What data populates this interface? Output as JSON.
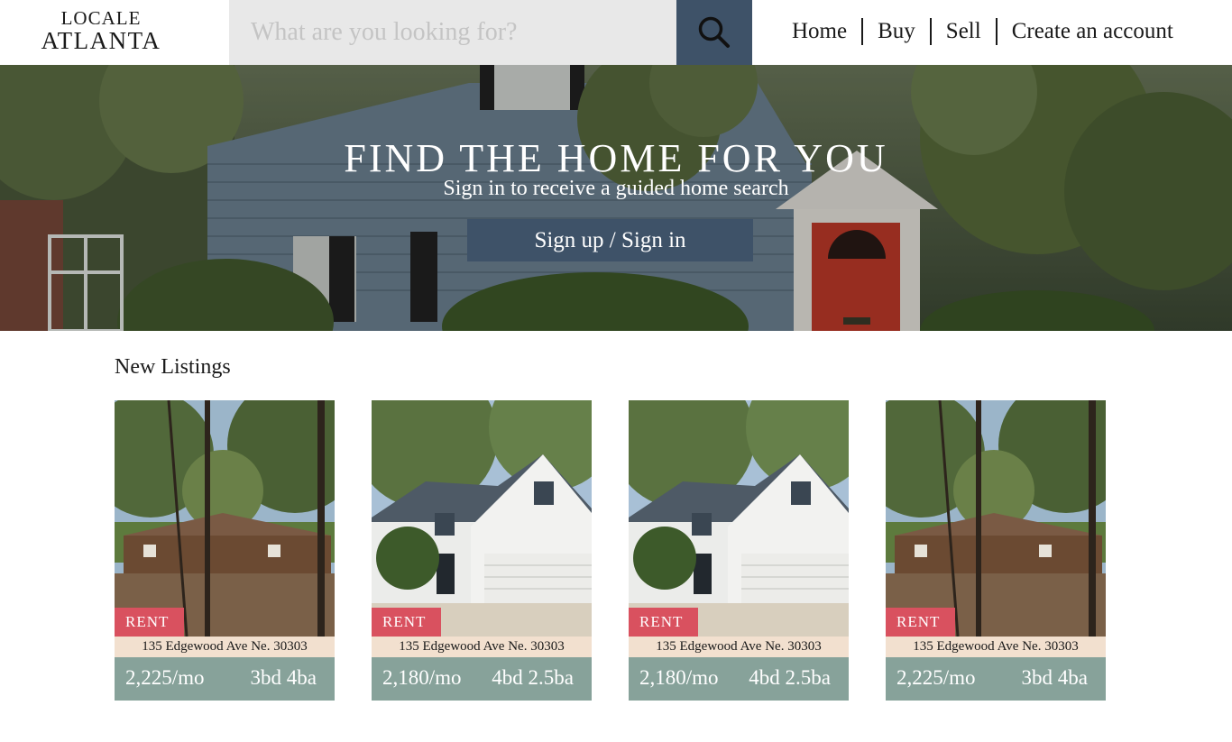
{
  "header": {
    "logo_line1": "LOCALE",
    "logo_line2": "ATLANTA",
    "search_placeholder": "What are you looking for?",
    "search_icon": "search-icon",
    "nav": [
      "Home",
      "Buy",
      "Sell",
      "Create an account"
    ]
  },
  "hero": {
    "title": "FIND THE HOME FOR YOU",
    "subtitle": "Sign in to receive a guided home search",
    "button": "Sign up / Sign in"
  },
  "listings": {
    "title": "New Listings",
    "items": [
      {
        "badge": "RENT",
        "address": "135 Edgewood Ave Ne. 30303",
        "price": "2,225/mo",
        "beds": "3bd 4ba"
      },
      {
        "badge": "RENT",
        "address": "135 Edgewood Ave Ne. 30303",
        "price": "2,180/mo",
        "beds": "4bd 2.5ba"
      },
      {
        "badge": "RENT",
        "address": "135 Edgewood Ave Ne. 30303",
        "price": "2,180/mo",
        "beds": "4bd 2.5ba"
      },
      {
        "badge": "RENT",
        "address": "135 Edgewood Ave Ne. 30303",
        "price": "2,225/mo",
        "beds": "3bd 4ba"
      }
    ]
  },
  "colors": {
    "navy": "#3e5268",
    "rent_badge": "#d9515f",
    "address_bg": "#f2e0cf",
    "info_bg": "#87a29a",
    "search_bg": "#e8e8e8"
  }
}
